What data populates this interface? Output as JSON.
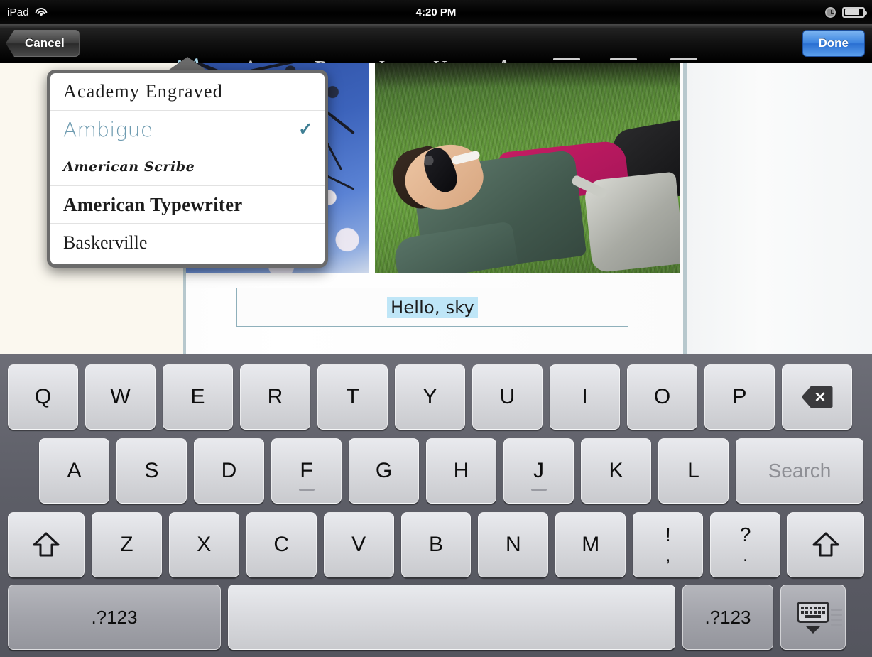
{
  "status_bar": {
    "carrier": "iPad",
    "wifi_icon": "wifi-icon",
    "time": "4:20 PM",
    "alarm_icon": "alarm-clock-icon",
    "battery_icon": "battery-icon"
  },
  "toolbar": {
    "cancel_label": "Cancel",
    "done_label": "Done",
    "items": [
      {
        "name": "font-picker-button",
        "glyph_main": "A",
        "glyph_alt": "A",
        "icon": "font-face-icon",
        "active": true
      },
      {
        "name": "font-size-button",
        "glyph_main": "A",
        "glyph_alt": "A",
        "icon": "font-size-icon",
        "active": false
      },
      {
        "name": "bold-button",
        "glyph": "B",
        "icon": "bold-icon",
        "active": false
      },
      {
        "name": "italic-button",
        "glyph": "I",
        "icon": "italic-icon",
        "active": false
      },
      {
        "name": "underline-button",
        "glyph": "U",
        "icon": "underline-icon",
        "active": false
      },
      {
        "name": "text-color-button",
        "glyph": "A",
        "icon": "text-color-icon",
        "active": false
      },
      {
        "name": "align-left-button",
        "icon": "align-left-icon",
        "active": false
      },
      {
        "name": "align-center-button",
        "icon": "align-center-icon",
        "active": false
      },
      {
        "name": "align-right-button",
        "icon": "align-right-icon",
        "active": false
      }
    ],
    "accent_done_color": "#3d85e0",
    "active_tint_color": "#a9d7ea"
  },
  "font_popover": {
    "selected_font": "Ambigue",
    "check_glyph": "✓",
    "check_color": "#3f7f94",
    "fonts": [
      {
        "name": "Academy Engraved",
        "selected": false
      },
      {
        "name": "Ambigue",
        "selected": true
      },
      {
        "name": "American Scribe",
        "selected": false
      },
      {
        "name": "American Typewriter",
        "selected": false
      },
      {
        "name": "Baskerville",
        "selected": false
      }
    ]
  },
  "document": {
    "background_color": "#fbf8ef",
    "photos": [
      {
        "name": "photo-blossom",
        "description": "cherry blossom branches against blue sky"
      },
      {
        "name": "photo-grass",
        "description": "person with sunglasses lying on grass"
      }
    ],
    "caption_field": {
      "value": "Hello, sky",
      "placeholder": "Hello, sky",
      "selection_highlight_color": "#bfe6f7",
      "border_color": "#8fb0bb"
    }
  },
  "keyboard": {
    "row1": [
      "Q",
      "W",
      "E",
      "R",
      "T",
      "Y",
      "U",
      "I",
      "O",
      "P"
    ],
    "backspace_icon": "backspace-icon",
    "backspace_glyph": "✕",
    "row2": [
      "A",
      "S",
      "D",
      "F",
      "G",
      "H",
      "J",
      "K",
      "L"
    ],
    "home_keys": [
      "F",
      "J"
    ],
    "return_label": "Search",
    "row3": [
      "Z",
      "X",
      "C",
      "V",
      "B",
      "N",
      "M"
    ],
    "shift_icon": "shift-icon",
    "punct_keys": [
      {
        "top": "!",
        "bottom": ","
      },
      {
        "top": "?",
        "bottom": "."
      }
    ],
    "numeric_label_left": ".?123",
    "numeric_label_right": ".?123",
    "space_label": "",
    "hide_keyboard_icon": "hide-keyboard-icon",
    "key_face_color": "#d9dade",
    "key_dark_color": "#a3a4ab",
    "deck_color": "#5d5e67"
  }
}
